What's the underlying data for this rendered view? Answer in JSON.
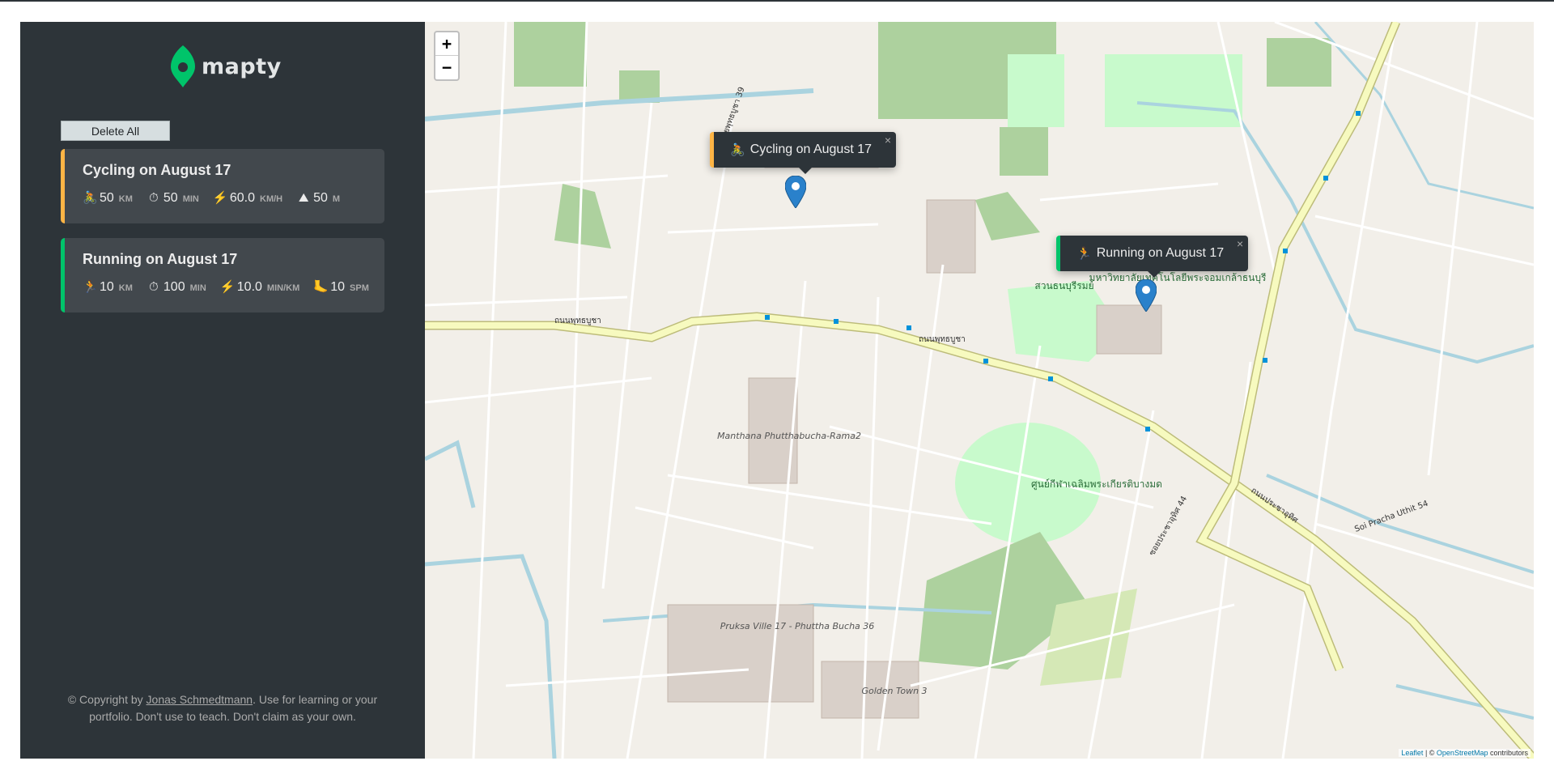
{
  "app": {
    "name": "mapty"
  },
  "sidebar": {
    "delete_all_label": "Delete All",
    "workouts": [
      {
        "type": "cycling",
        "title": "Cycling on August 17",
        "color": "#ffb545",
        "details": [
          {
            "icon": "🚴",
            "value": "50",
            "unit": "km"
          },
          {
            "icon": "⏱",
            "value": "50",
            "unit": "min"
          },
          {
            "icon": "⚡",
            "value": "60.0",
            "unit": "km/h"
          },
          {
            "icon": "⛰",
            "value": "50",
            "unit": "m"
          }
        ]
      },
      {
        "type": "running",
        "title": "Running on August 17",
        "color": "#00c46a",
        "details": [
          {
            "icon": "🏃",
            "value": "10",
            "unit": "km"
          },
          {
            "icon": "⏱",
            "value": "100",
            "unit": "min"
          },
          {
            "icon": "⚡",
            "value": "10.0",
            "unit": "min/km"
          },
          {
            "icon": "🦶",
            "value": "10",
            "unit": "spm"
          }
        ]
      }
    ],
    "copyright_prefix": "© Copyright by ",
    "copyright_author": "Jonas Schmedtmann",
    "copyright_suffix": ". Use for learning or your portfolio. Don't use to teach. Don't claim as your own."
  },
  "map": {
    "zoom_in": "+",
    "zoom_out": "−",
    "popups": [
      {
        "type": "cycling",
        "icon": "🚴",
        "text": "Cycling on August 17",
        "close": "×"
      },
      {
        "type": "running",
        "icon": "🏃",
        "text": "Running on August 17",
        "close": "×"
      }
    ],
    "attribution_leaflet": "Leaflet",
    "attribution_sep": " | © ",
    "attribution_osm": "OpenStreetMap",
    "attribution_suffix": " contributors",
    "labels": {
      "main_road_1": "ถนนพุทธบูชา",
      "main_road_2": "ถนนประชาอุทิศ",
      "university": "มหาวิทยาลัยเทคโนโลยีพระจอมเกล้าธนบุรี",
      "park": "สวนธนบุรีรมย์",
      "sports": "ศูนย์กีฬาเฉลิมพระเกียรติบางมด",
      "village_1": "Manthana Phutthabucha-Rama2",
      "village_2": "Pruksa Ville 17 - Phuttha Bucha 36",
      "village_3": "Golden Town 3",
      "soi_1": "Soi Pracha Uthit 54",
      "soi_2": "ซอยพุทธบูชา 39",
      "soi_3": "ซอยประชาอุทิศ 44"
    }
  }
}
